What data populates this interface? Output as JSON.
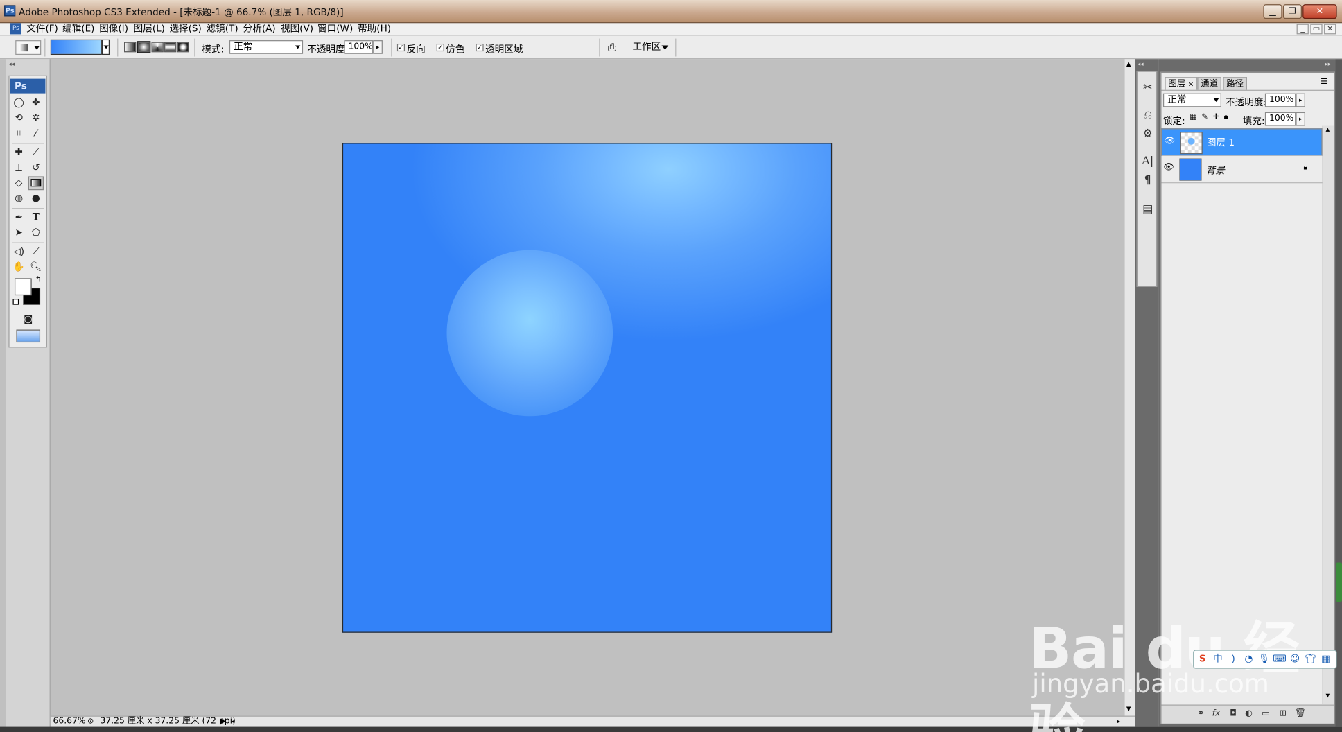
{
  "window": {
    "title": "Adobe Photoshop CS3 Extended - [未标题-1 @ 66.7% (图层 1, RGB/8)]",
    "app_icon": "Ps",
    "controls": [
      "minimize-icon",
      "restore-icon",
      "close-icon"
    ]
  },
  "menubar": {
    "items": [
      "文件(F)",
      "编辑(E)",
      "图像(I)",
      "图层(L)",
      "选择(S)",
      "滤镜(T)",
      "分析(A)",
      "视图(V)",
      "窗口(W)",
      "帮助(H)"
    ]
  },
  "options": {
    "mode_label": "模式:",
    "mode_value": "正常",
    "opacity_label": "不透明度:",
    "opacity_value": "100%",
    "reverse_label": "反向",
    "dither_label": "仿色",
    "transparency_label": "透明区域",
    "reverse_checked": "✓",
    "dither_checked": "✓",
    "transparency_checked": "✓",
    "workspace_label": "工作区",
    "gradient_colors": [
      "#3382f8",
      "#9dd6ff"
    ]
  },
  "toolbox": {
    "logo": "Ps",
    "foreground": "#ffffff",
    "background": "#000000"
  },
  "canvas": {
    "bg_color": "#3382f8",
    "highlight_color": "#8fd0ff"
  },
  "status": {
    "zoom": "66.67%",
    "doc_info": "37.25 厘米 x 37.25 厘米 (72 ppi)"
  },
  "layers_panel": {
    "tabs": [
      "图层",
      "通道",
      "路径"
    ],
    "blend_mode": "正常",
    "opacity_label": "不透明度:",
    "opacity_value": "100%",
    "lock_label": "锁定:",
    "fill_label": "填充:",
    "fill_value": "100%",
    "layers": [
      {
        "name": "图层 1",
        "selected": true
      },
      {
        "name": "背景",
        "selected": false,
        "locked": true
      }
    ],
    "selected_color": "#3a94fb"
  },
  "watermark": {
    "brand": "Bai du 经验",
    "url": "jingyan.baidu.com"
  },
  "ime": {
    "label": "中"
  }
}
